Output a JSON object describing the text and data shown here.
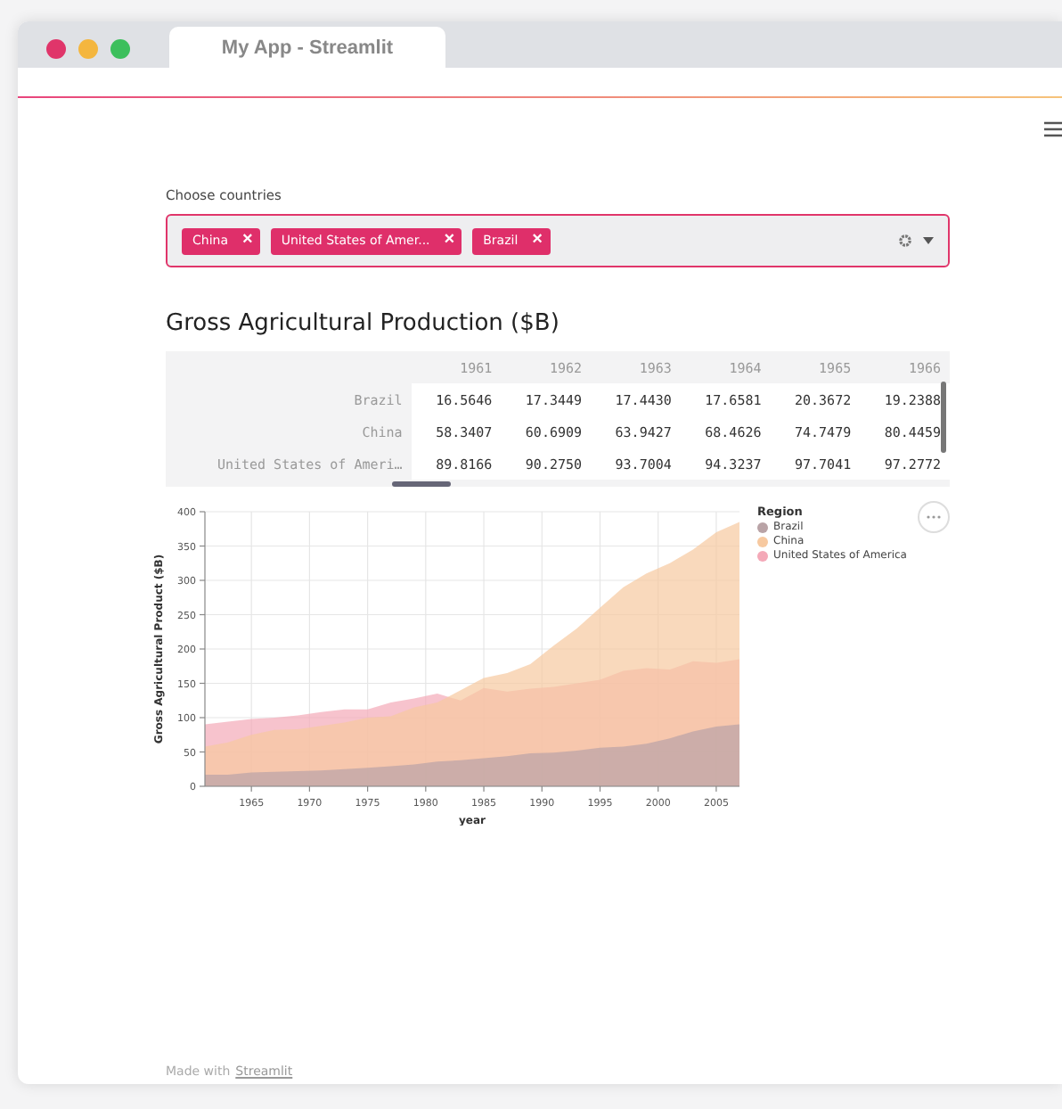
{
  "browser": {
    "tab_title": "My App - Streamlit"
  },
  "multiselect": {
    "label": "Choose countries",
    "tags": [
      {
        "label": "China",
        "remove": "×"
      },
      {
        "label": "United States of Amer...",
        "remove": "×"
      },
      {
        "label": "Brazil",
        "remove": "×"
      }
    ]
  },
  "heading": "Gross Agricultural Production ($B)",
  "table": {
    "columns": [
      "1961",
      "1962",
      "1963",
      "1964",
      "1965",
      "1966"
    ],
    "rows": [
      {
        "index": "Brazil",
        "cells": [
          "16.5646",
          "17.3449",
          "17.4430",
          "17.6581",
          "20.3672",
          "19.2388"
        ]
      },
      {
        "index": "China",
        "cells": [
          "58.3407",
          "60.6909",
          "63.9427",
          "68.4626",
          "74.7479",
          "80.4459"
        ]
      },
      {
        "index": "United States of Ameri…",
        "cells": [
          "89.8166",
          "90.2750",
          "93.7004",
          "94.3237",
          "97.7041",
          "97.2772"
        ]
      }
    ]
  },
  "legend_title": "Region",
  "chart_data": {
    "type": "area",
    "xlabel": "year",
    "ylabel": "Gross Agricultural Product ($B)",
    "stacked": false,
    "grid": true,
    "x": [
      1961,
      1963,
      1965,
      1967,
      1969,
      1971,
      1973,
      1975,
      1977,
      1979,
      1981,
      1983,
      1985,
      1987,
      1989,
      1991,
      1993,
      1995,
      1997,
      1999,
      2001,
      2003,
      2005,
      2007
    ],
    "series": [
      {
        "name": "Brazil",
        "color": "#b9a3a6",
        "values": [
          17,
          17,
          20,
          21,
          22,
          23,
          25,
          27,
          29,
          32,
          36,
          38,
          41,
          44,
          48,
          49,
          52,
          56,
          58,
          62,
          70,
          80,
          87,
          90
        ]
      },
      {
        "name": "China",
        "color": "#f7c9a0",
        "values": [
          58,
          64,
          75,
          82,
          83,
          88,
          93,
          100,
          102,
          115,
          122,
          140,
          158,
          165,
          178,
          205,
          230,
          260,
          290,
          310,
          325,
          345,
          370,
          385
        ]
      },
      {
        "name": "United States of America",
        "color": "#f4a9b8",
        "values": [
          90,
          94,
          98,
          100,
          103,
          108,
          112,
          112,
          122,
          128,
          135,
          125,
          143,
          138,
          142,
          145,
          150,
          155,
          168,
          172,
          170,
          182,
          180,
          185
        ]
      }
    ],
    "xlim": [
      1961,
      2007
    ],
    "ylim": [
      0,
      400
    ],
    "xticks": [
      1965,
      1970,
      1975,
      1980,
      1985,
      1990,
      1995,
      2000,
      2005
    ],
    "yticks": [
      0,
      50,
      100,
      150,
      200,
      250,
      300,
      350,
      400
    ]
  },
  "footer": {
    "text": "Made with",
    "link": "Streamlit"
  }
}
